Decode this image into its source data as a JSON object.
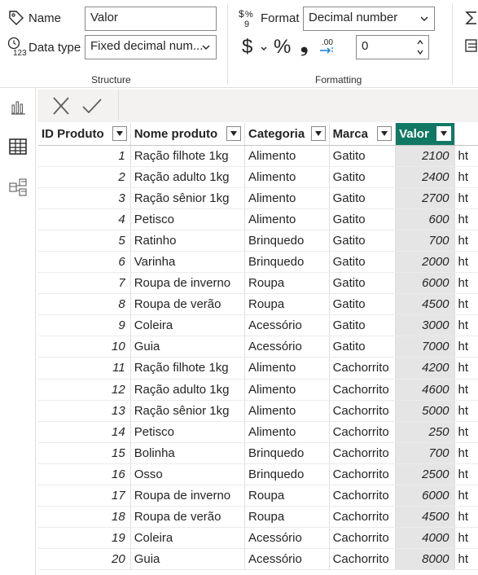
{
  "ribbon": {
    "structure": {
      "name_label": "Name",
      "name_value": "Valor",
      "datatype_label": "Data type",
      "datatype_value": "Fixed decimal num...",
      "group_title": "Structure"
    },
    "formatting": {
      "format_label": "Format",
      "format_value": "Decimal number",
      "currency_symbol": "$",
      "percent_symbol": "%",
      "comma_symbol": "❟",
      "decimals_value": "0",
      "group_title": "Formatting"
    },
    "icons": {
      "name": "tag-icon",
      "datatype": "datatype-123-icon",
      "format": "format-currency-percent-icon",
      "auto_decimal": "auto-decimal-icon",
      "right_edge_top": "sigma-icon",
      "right_edge_bottom": "properties-icon"
    }
  },
  "rail": {
    "items": [
      {
        "name": "report-view",
        "icon": "bar-chart-icon"
      },
      {
        "name": "table-view",
        "icon": "table-icon"
      },
      {
        "name": "model-view",
        "icon": "model-icon"
      }
    ]
  },
  "formula_bar": {
    "cancel_icon": "close-icon",
    "commit_icon": "check-icon"
  },
  "table": {
    "columns": [
      "ID Produto",
      "Nome produto",
      "Categoria",
      "Marca",
      "Valor",
      "ht"
    ],
    "selected_column": "Valor",
    "rows": [
      {
        "id": "1",
        "nome": "Ração filhote 1kg",
        "categoria": "Alimento",
        "marca": "Gatito",
        "valor": "2100",
        "extra": "ht"
      },
      {
        "id": "2",
        "nome": "Ração adulto 1kg",
        "categoria": "Alimento",
        "marca": "Gatito",
        "valor": "2400",
        "extra": "ht"
      },
      {
        "id": "3",
        "nome": "Ração sênior 1kg",
        "categoria": "Alimento",
        "marca": "Gatito",
        "valor": "2700",
        "extra": "ht"
      },
      {
        "id": "4",
        "nome": "Petisco",
        "categoria": "Alimento",
        "marca": "Gatito",
        "valor": "600",
        "extra": "ht"
      },
      {
        "id": "5",
        "nome": "Ratinho",
        "categoria": "Brinquedo",
        "marca": "Gatito",
        "valor": "700",
        "extra": "ht"
      },
      {
        "id": "6",
        "nome": "Varinha",
        "categoria": "Brinquedo",
        "marca": "Gatito",
        "valor": "2000",
        "extra": "ht"
      },
      {
        "id": "7",
        "nome": "Roupa de inverno",
        "categoria": "Roupa",
        "marca": "Gatito",
        "valor": "6000",
        "extra": "ht"
      },
      {
        "id": "8",
        "nome": "Roupa de verão",
        "categoria": "Roupa",
        "marca": "Gatito",
        "valor": "4500",
        "extra": "ht"
      },
      {
        "id": "9",
        "nome": "Coleira",
        "categoria": "Acessório",
        "marca": "Gatito",
        "valor": "3000",
        "extra": "ht"
      },
      {
        "id": "10",
        "nome": "Guia",
        "categoria": "Acessório",
        "marca": "Gatito",
        "valor": "7000",
        "extra": "ht"
      },
      {
        "id": "11",
        "nome": "Ração filhote 1kg",
        "categoria": "Alimento",
        "marca": "Cachorrito",
        "valor": "4200",
        "extra": "ht"
      },
      {
        "id": "12",
        "nome": "Ração adulto 1kg",
        "categoria": "Alimento",
        "marca": "Cachorrito",
        "valor": "4600",
        "extra": "ht"
      },
      {
        "id": "13",
        "nome": "Ração sênior 1kg",
        "categoria": "Alimento",
        "marca": "Cachorrito",
        "valor": "5000",
        "extra": "ht"
      },
      {
        "id": "14",
        "nome": "Petisco",
        "categoria": "Alimento",
        "marca": "Cachorrito",
        "valor": "250",
        "extra": "ht"
      },
      {
        "id": "15",
        "nome": "Bolinha",
        "categoria": "Brinquedo",
        "marca": "Cachorrito",
        "valor": "700",
        "extra": "ht"
      },
      {
        "id": "16",
        "nome": "Osso",
        "categoria": "Brinquedo",
        "marca": "Cachorrito",
        "valor": "2500",
        "extra": "ht"
      },
      {
        "id": "17",
        "nome": "Roupa de inverno",
        "categoria": "Roupa",
        "marca": "Cachorrito",
        "valor": "6000",
        "extra": "ht"
      },
      {
        "id": "18",
        "nome": "Roupa de verão",
        "categoria": "Roupa",
        "marca": "Cachorrito",
        "valor": "4500",
        "extra": "ht"
      },
      {
        "id": "19",
        "nome": "Coleira",
        "categoria": "Acessório",
        "marca": "Cachorrito",
        "valor": "4000",
        "extra": "ht"
      },
      {
        "id": "20",
        "nome": "Guia",
        "categoria": "Acessório",
        "marca": "Cachorrito",
        "valor": "8000",
        "extra": "ht"
      }
    ]
  },
  "colors": {
    "selected_header": "#117865",
    "selected_column_bg": "#e5e5e5",
    "grid_line": "#e1dfdd"
  }
}
